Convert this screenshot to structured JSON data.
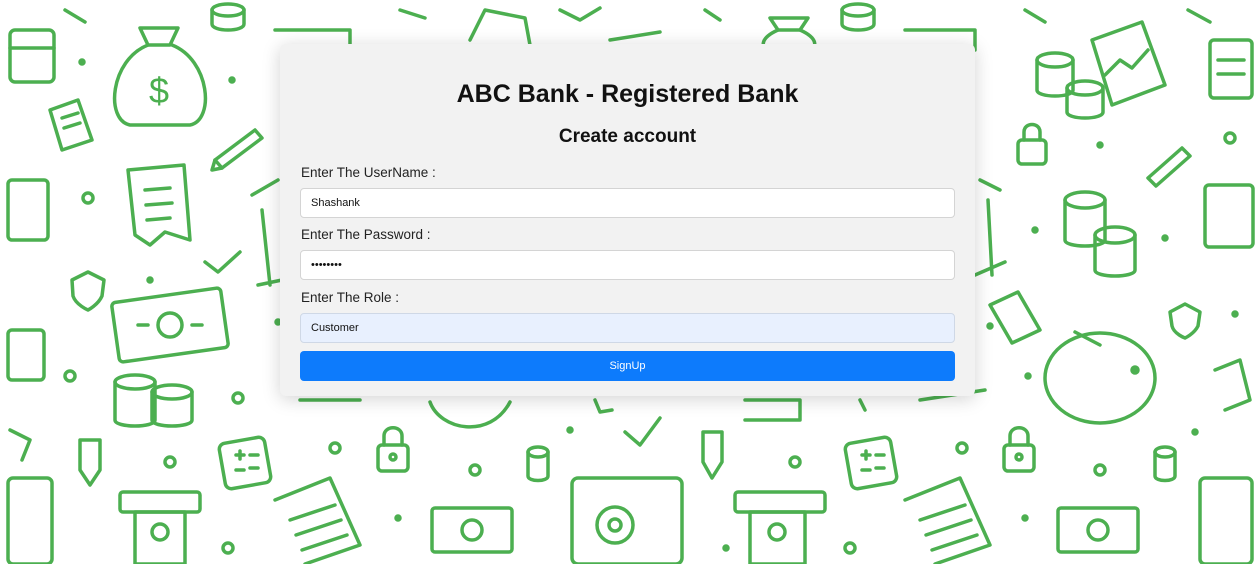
{
  "form": {
    "title": "ABC Bank - Registered Bank",
    "subtitle": "Create account",
    "username_label": "Enter The UserName :",
    "username_value": "Shashank",
    "password_label": "Enter The Password :",
    "password_value": "••••••••",
    "role_label": "Enter The Role :",
    "role_value": "Customer",
    "signup_label": "SignUp"
  },
  "colors": {
    "pattern_green": "#4caf50",
    "button_blue": "#0d7bfc",
    "card_bg": "#f2f2f2",
    "autofill_bg": "#e8f0fe"
  },
  "background_icons": [
    "money-bag-icon",
    "coin-stack-icon",
    "wallet-icon",
    "receipt-icon",
    "pencil-icon",
    "check-icon",
    "shield-icon",
    "banknote-icon",
    "bank-building-icon",
    "padlock-icon",
    "calculator-icon",
    "piggy-bank-icon",
    "safe-icon",
    "atm-icon",
    "chart-document-icon",
    "spreadsheet-icon"
  ]
}
